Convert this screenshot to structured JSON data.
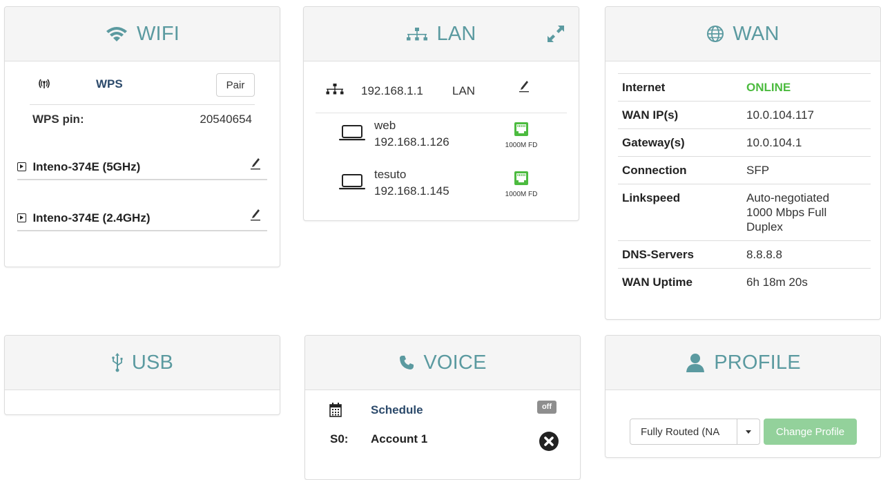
{
  "wifi": {
    "title": "WIFI",
    "wps_label": "WPS",
    "pair_label": "Pair",
    "wps_pin_label": "WPS pin:",
    "wps_pin_value": "20540654",
    "ssids": [
      {
        "name": "Inteno-374E (5GHz)"
      },
      {
        "name": "Inteno-374E (2.4GHz)"
      }
    ]
  },
  "lan": {
    "title": "LAN",
    "ip": "192.168.1.1",
    "name": "LAN",
    "clients": [
      {
        "name": "web",
        "ip": "192.168.1.126",
        "speed": "1000M FD"
      },
      {
        "name": "tesuto",
        "ip": "192.168.1.145",
        "speed": "1000M FD"
      }
    ]
  },
  "wan": {
    "title": "WAN",
    "rows": [
      {
        "key": "Internet",
        "value": "ONLINE"
      },
      {
        "key": "WAN IP(s)",
        "value": "10.0.104.117"
      },
      {
        "key": "Gateway(s)",
        "value": "10.0.104.1"
      },
      {
        "key": "Connection",
        "value": "SFP"
      },
      {
        "key": "Linkspeed",
        "value": "Auto-negotiated 1000 Mbps Full Duplex"
      },
      {
        "key": "DNS-Servers",
        "value": "8.8.8.8"
      },
      {
        "key": "WAN Uptime",
        "value": "6h 18m 20s"
      }
    ],
    "online_color": "#4cbb3f"
  },
  "usb": {
    "title": "USB"
  },
  "voice": {
    "title": "VOICE",
    "schedule_label": "Schedule",
    "schedule_state": "off",
    "account_line": "S0:",
    "account_name": "Account 1"
  },
  "profile": {
    "title": "PROFILE",
    "selected_profile": "Fully Routed (NA",
    "change_label": "Change Profile"
  },
  "colors": {
    "header_text": "#5b9aa0",
    "link_text": "#2c4a6b",
    "port_green": "#4cbb3f",
    "button_green": "#93d19b"
  }
}
